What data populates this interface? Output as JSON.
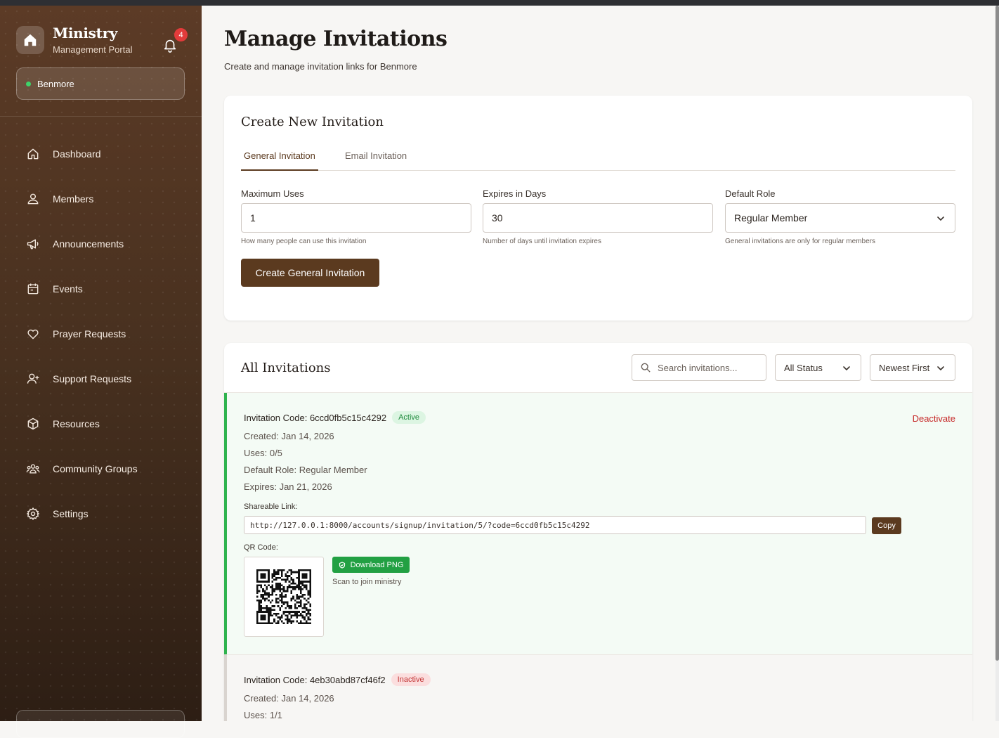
{
  "sidebar": {
    "brand_title": "Ministry",
    "brand_subtitle": "Management Portal",
    "notification_count": "4",
    "ministry_name": "Benmore",
    "items": [
      {
        "label": "Dashboard",
        "icon": "home-icon"
      },
      {
        "label": "Members",
        "icon": "users-icon"
      },
      {
        "label": "Announcements",
        "icon": "megaphone-icon"
      },
      {
        "label": "Events",
        "icon": "calendar-icon"
      },
      {
        "label": "Prayer Requests",
        "icon": "heart-icon"
      },
      {
        "label": "Support Requests",
        "icon": "user-plus-icon"
      },
      {
        "label": "Resources",
        "icon": "box-icon"
      },
      {
        "label": "Community Groups",
        "icon": "group-icon"
      },
      {
        "label": "Settings",
        "icon": "gear-icon"
      }
    ]
  },
  "page": {
    "title": "Manage Invitations",
    "subtitle": "Create and manage invitation links for Benmore"
  },
  "create": {
    "title": "Create New Invitation",
    "tabs": [
      "General Invitation",
      "Email Invitation"
    ],
    "active_tab": "General Invitation",
    "max_uses": {
      "label": "Maximum Uses",
      "value": "1",
      "help": "How many people can use this invitation"
    },
    "expires": {
      "label": "Expires in Days",
      "value": "30",
      "help": "Number of days until invitation expires"
    },
    "role": {
      "label": "Default Role",
      "value": "Regular Member",
      "help": "General invitations are only for regular members"
    },
    "submit_label": "Create General Invitation"
  },
  "list": {
    "title": "All Invitations",
    "search_placeholder": "Search invitations...",
    "status_filter": "All Status",
    "sort": "Newest First",
    "invitations": [
      {
        "code_label": "Invitation Code: 6ccd0fb5c15c4292",
        "status": "Active",
        "action": "Deactivate",
        "created": "Created: Jan 14, 2026",
        "uses": "Uses: 0/5",
        "role": "Default Role: Regular Member",
        "expires": "Expires: Jan 21, 2026",
        "link_label": "Shareable Link:",
        "link": "http://127.0.0.1:8000/accounts/signup/invitation/5/?code=6ccd0fb5c15c4292",
        "copy_label": "Copy",
        "qr_label": "QR Code:",
        "download_label": "Download PNG",
        "scan_text": "Scan to join ministry"
      },
      {
        "code_label": "Invitation Code: 4eb30abd87cf46f2",
        "status": "Inactive",
        "created": "Created: Jan 14, 2026",
        "uses": "Uses: 1/1"
      }
    ]
  },
  "colors": {
    "brand_brown": "#5b3a1f",
    "active_green": "#2fb34e",
    "danger_red": "#c62a2a",
    "badge_red": "#e23b3b"
  }
}
